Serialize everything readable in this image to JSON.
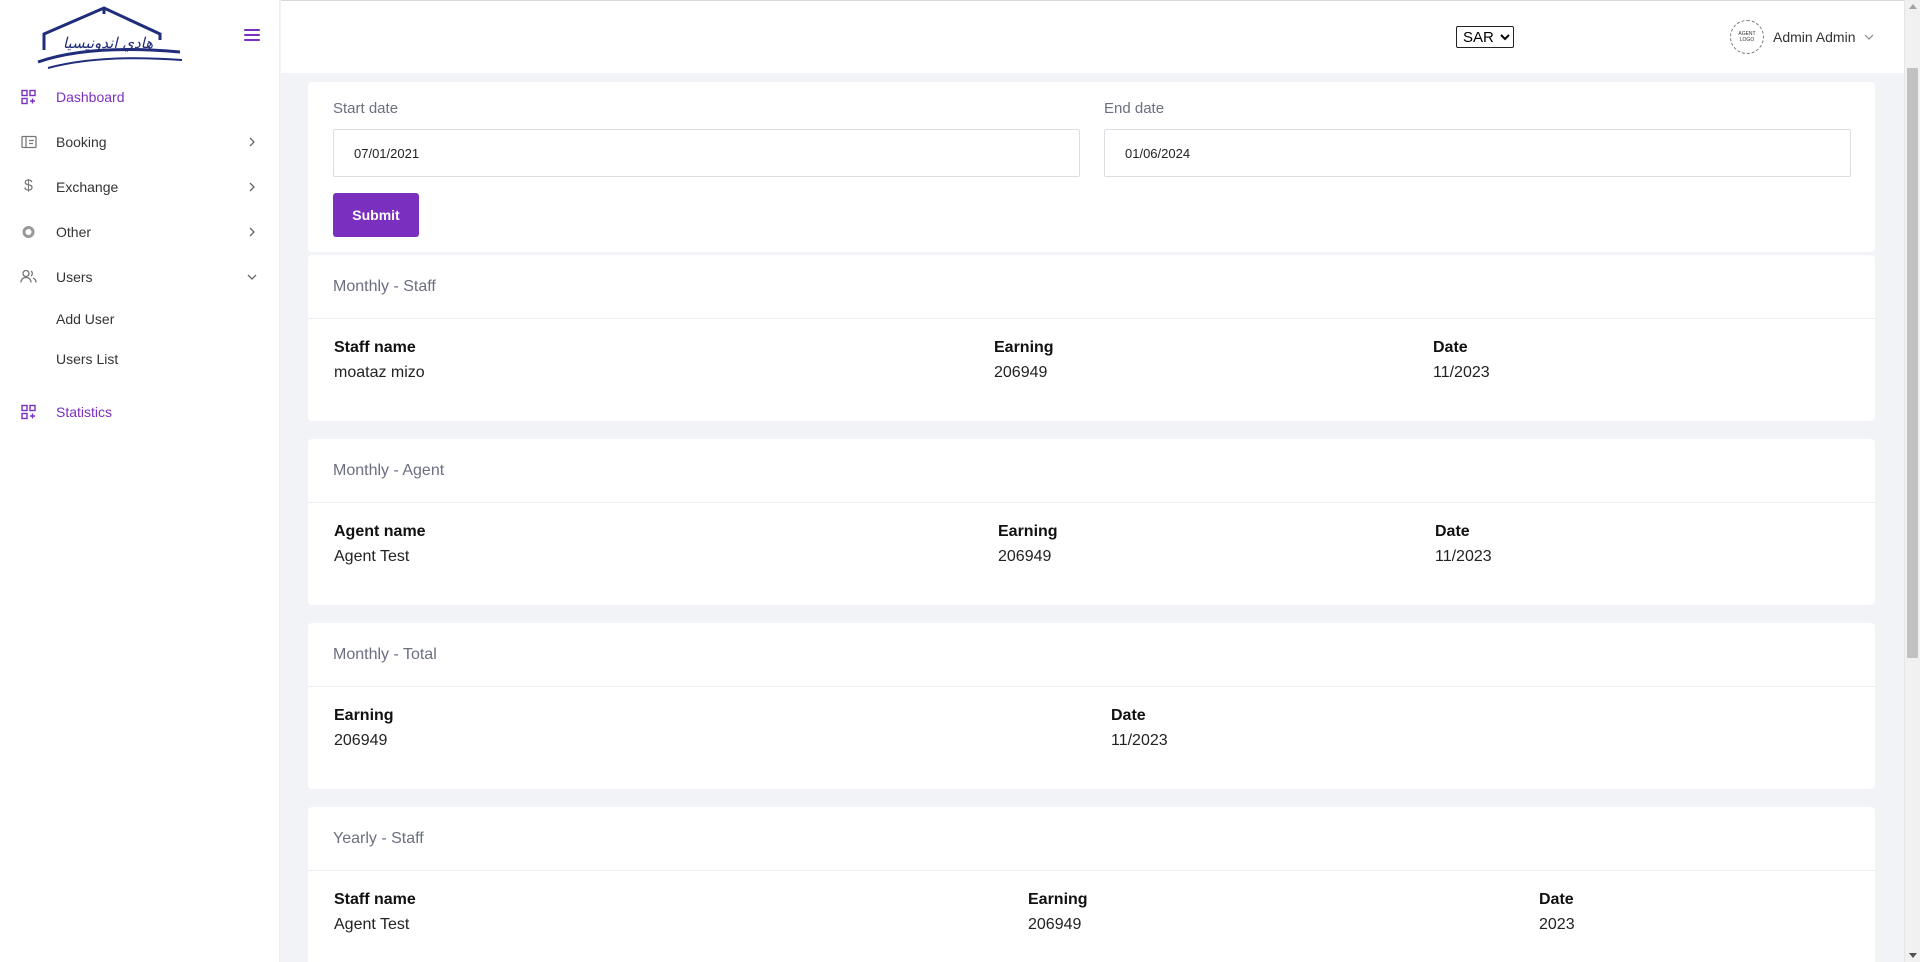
{
  "brand": {
    "logo_text": "هادي اندونيسيا"
  },
  "sidebar": {
    "items": [
      {
        "label": "Dashboard",
        "icon": "dashboard-grid-icon"
      },
      {
        "label": "Booking",
        "icon": "ticket-icon"
      },
      {
        "label": "Exchange",
        "icon": "dollar-icon"
      },
      {
        "label": "Other",
        "icon": "circle-icon"
      },
      {
        "label": "Users",
        "icon": "users-icon"
      }
    ],
    "users_sub": [
      "Add User",
      "Users List"
    ],
    "statistics": {
      "label": "Statistics",
      "icon": "dashboard-grid-icon"
    }
  },
  "header": {
    "currency": "SAR",
    "currency_options": [
      "SAR"
    ],
    "avatar_text": "AGENT LOGO",
    "user_name": "Admin Admin"
  },
  "filter": {
    "start_label": "Start date",
    "start_value": "07/01/2021",
    "end_label": "End date",
    "end_value": "01/06/2024",
    "submit_label": "Submit"
  },
  "sections": {
    "monthly_staff": {
      "title": "Monthly - Staff",
      "headers": [
        "Staff name",
        "Earning",
        "Date"
      ],
      "values": [
        "moataz mizo",
        "206949",
        "11/2023"
      ]
    },
    "monthly_agent": {
      "title": "Monthly - Agent",
      "headers": [
        "Agent name",
        "Earning",
        "Date"
      ],
      "values": [
        "Agent Test",
        "206949",
        "11/2023"
      ]
    },
    "monthly_total": {
      "title": "Monthly - Total",
      "headers": [
        "Earning",
        "Date"
      ],
      "values": [
        "206949",
        "11/2023"
      ]
    },
    "yearly_staff": {
      "title": "Yearly - Staff",
      "headers": [
        "Staff name",
        "Earning",
        "Date"
      ],
      "values": [
        "Agent Test",
        "206949",
        "2023"
      ]
    }
  },
  "colors": {
    "accent": "#7b2fbf",
    "muted_text": "#6b6f80",
    "background": "#f2f3f6"
  }
}
